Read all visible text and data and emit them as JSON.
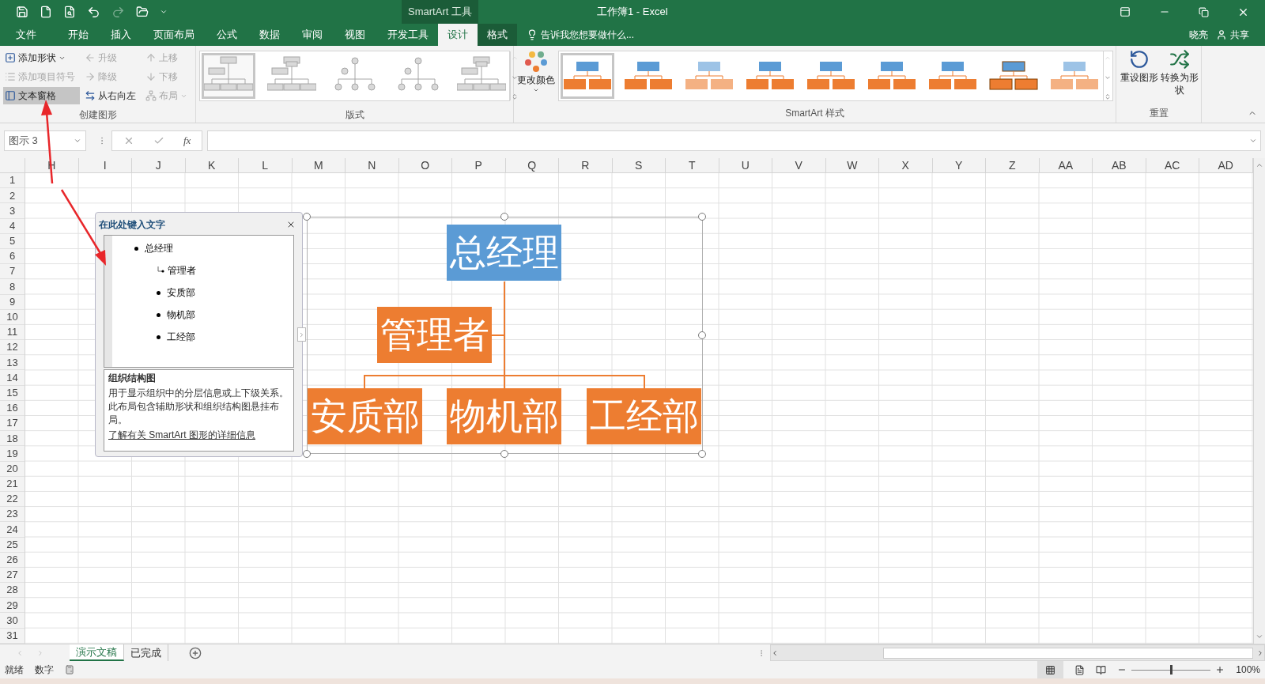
{
  "title_bar": {
    "context_label": "SmartArt 工具",
    "title": "工作簿1 - Excel"
  },
  "menu_tabs": [
    {
      "label": "文件",
      "selected": false,
      "kind": "normal"
    },
    {
      "label": "开始",
      "selected": false,
      "kind": "normal"
    },
    {
      "label": "插入",
      "selected": false,
      "kind": "normal"
    },
    {
      "label": "页面布局",
      "selected": false,
      "kind": "normal"
    },
    {
      "label": "公式",
      "selected": false,
      "kind": "normal"
    },
    {
      "label": "数据",
      "selected": false,
      "kind": "normal"
    },
    {
      "label": "审阅",
      "selected": false,
      "kind": "normal"
    },
    {
      "label": "视图",
      "selected": false,
      "kind": "normal"
    },
    {
      "label": "开发工具",
      "selected": false,
      "kind": "normal"
    },
    {
      "label": "设计",
      "selected": true,
      "kind": "contextual"
    },
    {
      "label": "格式",
      "selected": false,
      "kind": "contextual"
    }
  ],
  "tell_me": "告诉我您想要做什么...",
  "user": "晓亮",
  "share": "共享",
  "ribbon": {
    "create_graphic": {
      "label": "创建图形",
      "items": [
        {
          "label": "添加形状",
          "disabled": false,
          "pressed": false,
          "dropdown": true
        },
        {
          "label": "添加项目符号",
          "disabled": true,
          "pressed": false,
          "dropdown": false
        },
        {
          "label": "文本窗格",
          "disabled": false,
          "pressed": true,
          "dropdown": false
        },
        {
          "label": "升级",
          "disabled": true,
          "pressed": false,
          "dropdown": false
        },
        {
          "label": "降级",
          "disabled": true,
          "pressed": false,
          "dropdown": false
        },
        {
          "label": "从右向左",
          "disabled": false,
          "pressed": false,
          "dropdown": false
        },
        {
          "label": "上移",
          "disabled": true,
          "pressed": false,
          "dropdown": false
        },
        {
          "label": "下移",
          "disabled": true,
          "pressed": false,
          "dropdown": false
        },
        {
          "label": "布局",
          "disabled": true,
          "pressed": false,
          "dropdown": true
        }
      ]
    },
    "layouts": {
      "label": "版式",
      "thumbnails": [
        {
          "selected": true
        },
        {
          "selected": false
        },
        {
          "selected": false
        },
        {
          "selected": false
        },
        {
          "selected": false
        }
      ]
    },
    "styles": {
      "label": "SmartArt 样式",
      "change_colors": "更改颜色",
      "thumbnails": [
        {
          "selected": true
        },
        {
          "selected": false
        },
        {
          "selected": false
        },
        {
          "selected": false
        },
        {
          "selected": false
        },
        {
          "selected": false
        },
        {
          "selected": false
        },
        {
          "selected": false
        },
        {
          "selected": false
        }
      ]
    },
    "reset": {
      "label": "重置",
      "buttons": [
        "重设图形",
        "转换为形状"
      ]
    }
  },
  "formula_bar": {
    "name_box": "图示 3",
    "fx": "fx"
  },
  "columns": [
    "H",
    "I",
    "J",
    "K",
    "L",
    "M",
    "N",
    "O",
    "P",
    "Q",
    "R",
    "S",
    "T",
    "U",
    "V",
    "W",
    "X",
    "Y",
    "Z",
    "AA",
    "AB",
    "AC",
    "AD"
  ],
  "rows": [
    "1",
    "2",
    "3",
    "4",
    "5",
    "6",
    "7",
    "8",
    "9",
    "10",
    "11",
    "12",
    "13",
    "14",
    "15",
    "16",
    "17",
    "18",
    "19",
    "20",
    "21",
    "22",
    "23",
    "24",
    "25",
    "26",
    "27",
    "28",
    "29",
    "30",
    "31"
  ],
  "text_pane": {
    "title": "在此处键入文字",
    "items": [
      {
        "text": "总经理",
        "kind": "bullet",
        "children": [
          {
            "text": "管理者",
            "kind": "assistant"
          },
          {
            "text": "安质部",
            "kind": "bullet"
          },
          {
            "text": "物机部",
            "kind": "bullet"
          },
          {
            "text": "工经部",
            "kind": "bullet"
          }
        ]
      }
    ],
    "info_title": "组织结构图",
    "info_body": "用于显示组织中的分层信息或上下级关系。此布局包含辅助形状和组织结构图悬挂布局。",
    "info_link": "了解有关 SmartArt 图形的详细信息"
  },
  "smartart": {
    "top": {
      "text": "总经理",
      "color": "#5b9bd5"
    },
    "assistant": {
      "text": "管理者",
      "color": "#ed7d31"
    },
    "subordinates": [
      {
        "text": "安质部",
        "color": "#ed7d31"
      },
      {
        "text": "物机部",
        "color": "#ed7d31"
      },
      {
        "text": "工经部",
        "color": "#ed7d31"
      }
    ]
  },
  "sheet_tabs": [
    {
      "label": "演示文稿",
      "selected": true
    },
    {
      "label": "已完成",
      "selected": false
    }
  ],
  "status_bar": {
    "items": [
      "就绪",
      "数字"
    ],
    "zoom": "100%",
    "zoom_slider": {
      "level": 0.5
    }
  }
}
